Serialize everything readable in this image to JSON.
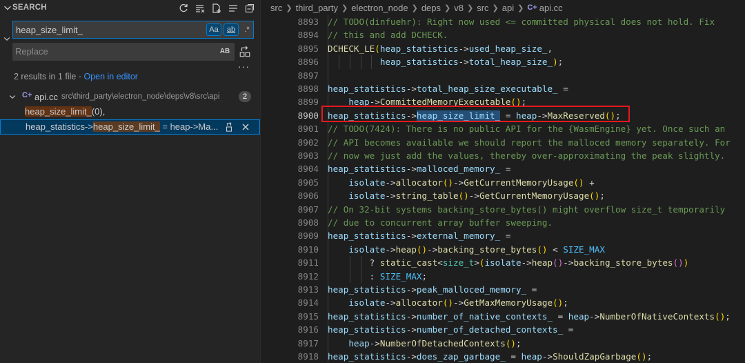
{
  "sidebar": {
    "title": "SEARCH",
    "search": {
      "value": "heap_size_limit_",
      "opt_case": "Aa",
      "opt_word": "ab",
      "opt_regex": ".*"
    },
    "replace": {
      "placeholder": "Replace",
      "opt_preserve": "AB"
    },
    "more": "···",
    "summary_text": "2 results in 1 file - ",
    "summary_link": "Open in editor",
    "file": {
      "icon": "C+",
      "name": "api.cc",
      "path": "src\\third_party\\electron_node\\deps\\v8\\src\\api",
      "count": "2"
    },
    "matches": [
      {
        "hit": "heap_size_limit_",
        "after": "(0),"
      },
      {
        "before": "heap_statistics->",
        "hit": "heap_size_limit_",
        "after": " = heap->Ma..."
      }
    ]
  },
  "editor": {
    "breadcrumb": [
      "src",
      "third_party",
      "electron_node",
      "deps",
      "v8",
      "src",
      "api",
      "api.cc"
    ],
    "breadcrumb_icon": "C+",
    "current_line": "8900",
    "line_numbers": [
      "8893",
      "8894",
      "8895",
      "8896",
      "8897",
      "8898",
      "8899",
      "8900",
      "8901",
      "8902",
      "8903",
      "8904",
      "8905",
      "8906",
      "8907",
      "8908",
      "8909",
      "8910",
      "8911",
      "8912",
      "8913",
      "8914",
      "8915",
      "8916",
      "8917",
      "8918"
    ]
  },
  "colors": {
    "accent": "#007fd4",
    "match_highlight": "#613214",
    "selection": "#264f78",
    "annotation_box": "#e5191c"
  }
}
